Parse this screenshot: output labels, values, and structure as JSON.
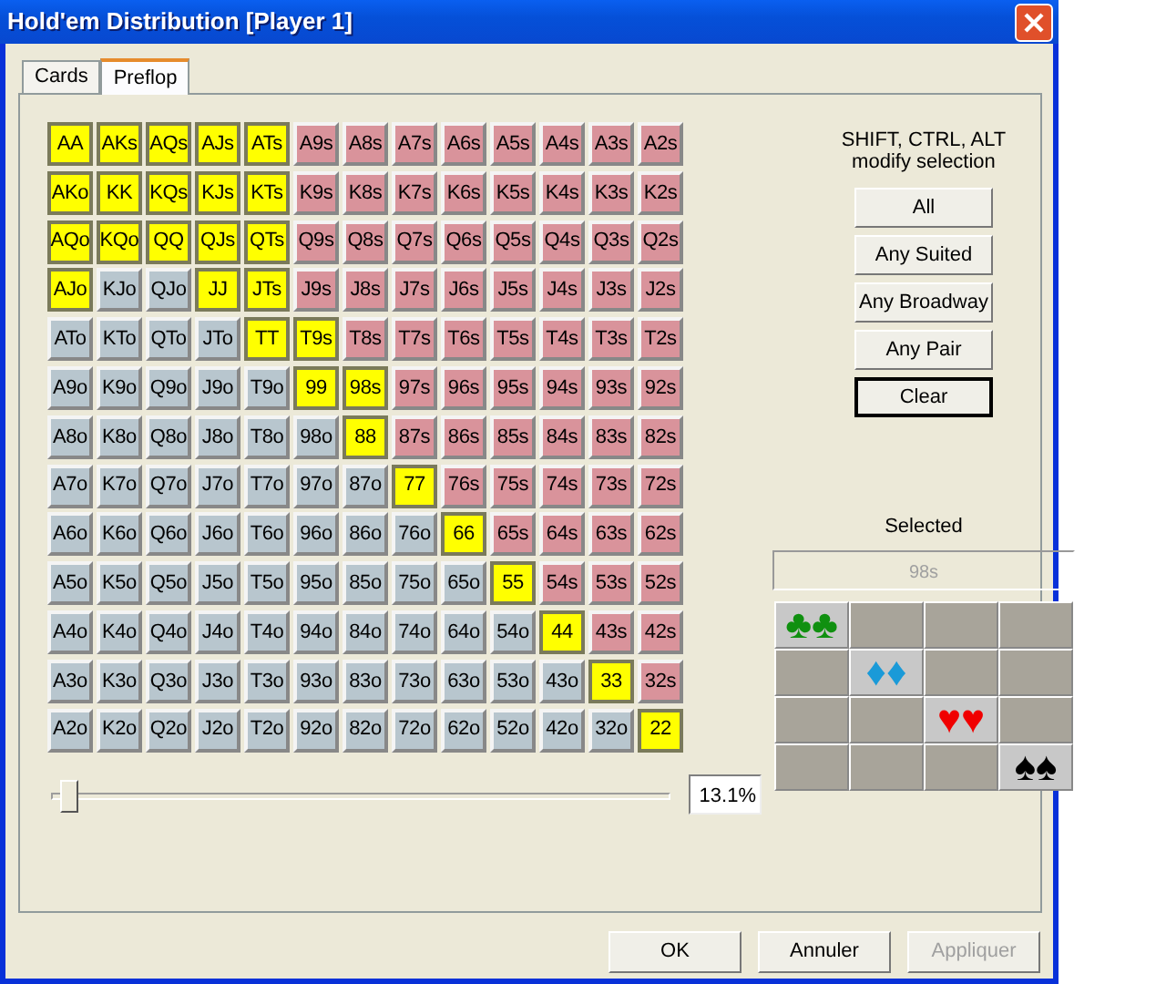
{
  "window": {
    "title": "Hold'em Distribution [Player 1]"
  },
  "tabs": [
    {
      "label": "Cards",
      "selected": false
    },
    {
      "label": "Preflop",
      "selected": true
    }
  ],
  "hand_grid": [
    [
      {
        "label": "AA",
        "kind": "pair",
        "selected": true
      },
      {
        "label": "AKs",
        "kind": "suited",
        "selected": true
      },
      {
        "label": "AQs",
        "kind": "suited",
        "selected": true
      },
      {
        "label": "AJs",
        "kind": "suited",
        "selected": true
      },
      {
        "label": "ATs",
        "kind": "suited",
        "selected": true
      },
      {
        "label": "A9s",
        "kind": "suited",
        "selected": false
      },
      {
        "label": "A8s",
        "kind": "suited",
        "selected": false
      },
      {
        "label": "A7s",
        "kind": "suited",
        "selected": false
      },
      {
        "label": "A6s",
        "kind": "suited",
        "selected": false
      },
      {
        "label": "A5s",
        "kind": "suited",
        "selected": false
      },
      {
        "label": "A4s",
        "kind": "suited",
        "selected": false
      },
      {
        "label": "A3s",
        "kind": "suited",
        "selected": false
      },
      {
        "label": "A2s",
        "kind": "suited",
        "selected": false
      }
    ],
    [
      {
        "label": "AKo",
        "kind": "offsuit",
        "selected": true
      },
      {
        "label": "KK",
        "kind": "pair",
        "selected": true
      },
      {
        "label": "KQs",
        "kind": "suited",
        "selected": true
      },
      {
        "label": "KJs",
        "kind": "suited",
        "selected": true
      },
      {
        "label": "KTs",
        "kind": "suited",
        "selected": true
      },
      {
        "label": "K9s",
        "kind": "suited",
        "selected": false
      },
      {
        "label": "K8s",
        "kind": "suited",
        "selected": false
      },
      {
        "label": "K7s",
        "kind": "suited",
        "selected": false
      },
      {
        "label": "K6s",
        "kind": "suited",
        "selected": false
      },
      {
        "label": "K5s",
        "kind": "suited",
        "selected": false
      },
      {
        "label": "K4s",
        "kind": "suited",
        "selected": false
      },
      {
        "label": "K3s",
        "kind": "suited",
        "selected": false
      },
      {
        "label": "K2s",
        "kind": "suited",
        "selected": false
      }
    ],
    [
      {
        "label": "AQo",
        "kind": "offsuit",
        "selected": true
      },
      {
        "label": "KQo",
        "kind": "offsuit",
        "selected": true
      },
      {
        "label": "QQ",
        "kind": "pair",
        "selected": true
      },
      {
        "label": "QJs",
        "kind": "suited",
        "selected": true
      },
      {
        "label": "QTs",
        "kind": "suited",
        "selected": true
      },
      {
        "label": "Q9s",
        "kind": "suited",
        "selected": false
      },
      {
        "label": "Q8s",
        "kind": "suited",
        "selected": false
      },
      {
        "label": "Q7s",
        "kind": "suited",
        "selected": false
      },
      {
        "label": "Q6s",
        "kind": "suited",
        "selected": false
      },
      {
        "label": "Q5s",
        "kind": "suited",
        "selected": false
      },
      {
        "label": "Q4s",
        "kind": "suited",
        "selected": false
      },
      {
        "label": "Q3s",
        "kind": "suited",
        "selected": false
      },
      {
        "label": "Q2s",
        "kind": "suited",
        "selected": false
      }
    ],
    [
      {
        "label": "AJo",
        "kind": "offsuit",
        "selected": true
      },
      {
        "label": "KJo",
        "kind": "offsuit",
        "selected": false
      },
      {
        "label": "QJo",
        "kind": "offsuit",
        "selected": false
      },
      {
        "label": "JJ",
        "kind": "pair",
        "selected": true
      },
      {
        "label": "JTs",
        "kind": "suited",
        "selected": true
      },
      {
        "label": "J9s",
        "kind": "suited",
        "selected": false
      },
      {
        "label": "J8s",
        "kind": "suited",
        "selected": false
      },
      {
        "label": "J7s",
        "kind": "suited",
        "selected": false
      },
      {
        "label": "J6s",
        "kind": "suited",
        "selected": false
      },
      {
        "label": "J5s",
        "kind": "suited",
        "selected": false
      },
      {
        "label": "J4s",
        "kind": "suited",
        "selected": false
      },
      {
        "label": "J3s",
        "kind": "suited",
        "selected": false
      },
      {
        "label": "J2s",
        "kind": "suited",
        "selected": false
      }
    ],
    [
      {
        "label": "ATo",
        "kind": "offsuit",
        "selected": false
      },
      {
        "label": "KTo",
        "kind": "offsuit",
        "selected": false
      },
      {
        "label": "QTo",
        "kind": "offsuit",
        "selected": false
      },
      {
        "label": "JTo",
        "kind": "offsuit",
        "selected": false
      },
      {
        "label": "TT",
        "kind": "pair",
        "selected": true
      },
      {
        "label": "T9s",
        "kind": "suited",
        "selected": true
      },
      {
        "label": "T8s",
        "kind": "suited",
        "selected": false
      },
      {
        "label": "T7s",
        "kind": "suited",
        "selected": false
      },
      {
        "label": "T6s",
        "kind": "suited",
        "selected": false
      },
      {
        "label": "T5s",
        "kind": "suited",
        "selected": false
      },
      {
        "label": "T4s",
        "kind": "suited",
        "selected": false
      },
      {
        "label": "T3s",
        "kind": "suited",
        "selected": false
      },
      {
        "label": "T2s",
        "kind": "suited",
        "selected": false
      }
    ],
    [
      {
        "label": "A9o",
        "kind": "offsuit",
        "selected": false
      },
      {
        "label": "K9o",
        "kind": "offsuit",
        "selected": false
      },
      {
        "label": "Q9o",
        "kind": "offsuit",
        "selected": false
      },
      {
        "label": "J9o",
        "kind": "offsuit",
        "selected": false
      },
      {
        "label": "T9o",
        "kind": "offsuit",
        "selected": false
      },
      {
        "label": "99",
        "kind": "pair",
        "selected": true
      },
      {
        "label": "98s",
        "kind": "suited",
        "selected": true
      },
      {
        "label": "97s",
        "kind": "suited",
        "selected": false
      },
      {
        "label": "96s",
        "kind": "suited",
        "selected": false
      },
      {
        "label": "95s",
        "kind": "suited",
        "selected": false
      },
      {
        "label": "94s",
        "kind": "suited",
        "selected": false
      },
      {
        "label": "93s",
        "kind": "suited",
        "selected": false
      },
      {
        "label": "92s",
        "kind": "suited",
        "selected": false
      }
    ],
    [
      {
        "label": "A8o",
        "kind": "offsuit",
        "selected": false
      },
      {
        "label": "K8o",
        "kind": "offsuit",
        "selected": false
      },
      {
        "label": "Q8o",
        "kind": "offsuit",
        "selected": false
      },
      {
        "label": "J8o",
        "kind": "offsuit",
        "selected": false
      },
      {
        "label": "T8o",
        "kind": "offsuit",
        "selected": false
      },
      {
        "label": "98o",
        "kind": "offsuit",
        "selected": false
      },
      {
        "label": "88",
        "kind": "pair",
        "selected": true
      },
      {
        "label": "87s",
        "kind": "suited",
        "selected": false
      },
      {
        "label": "86s",
        "kind": "suited",
        "selected": false
      },
      {
        "label": "85s",
        "kind": "suited",
        "selected": false
      },
      {
        "label": "84s",
        "kind": "suited",
        "selected": false
      },
      {
        "label": "83s",
        "kind": "suited",
        "selected": false
      },
      {
        "label": "82s",
        "kind": "suited",
        "selected": false
      }
    ],
    [
      {
        "label": "A7o",
        "kind": "offsuit",
        "selected": false
      },
      {
        "label": "K7o",
        "kind": "offsuit",
        "selected": false
      },
      {
        "label": "Q7o",
        "kind": "offsuit",
        "selected": false
      },
      {
        "label": "J7o",
        "kind": "offsuit",
        "selected": false
      },
      {
        "label": "T7o",
        "kind": "offsuit",
        "selected": false
      },
      {
        "label": "97o",
        "kind": "offsuit",
        "selected": false
      },
      {
        "label": "87o",
        "kind": "offsuit",
        "selected": false
      },
      {
        "label": "77",
        "kind": "pair",
        "selected": true
      },
      {
        "label": "76s",
        "kind": "suited",
        "selected": false
      },
      {
        "label": "75s",
        "kind": "suited",
        "selected": false
      },
      {
        "label": "74s",
        "kind": "suited",
        "selected": false
      },
      {
        "label": "73s",
        "kind": "suited",
        "selected": false
      },
      {
        "label": "72s",
        "kind": "suited",
        "selected": false
      }
    ],
    [
      {
        "label": "A6o",
        "kind": "offsuit",
        "selected": false
      },
      {
        "label": "K6o",
        "kind": "offsuit",
        "selected": false
      },
      {
        "label": "Q6o",
        "kind": "offsuit",
        "selected": false
      },
      {
        "label": "J6o",
        "kind": "offsuit",
        "selected": false
      },
      {
        "label": "T6o",
        "kind": "offsuit",
        "selected": false
      },
      {
        "label": "96o",
        "kind": "offsuit",
        "selected": false
      },
      {
        "label": "86o",
        "kind": "offsuit",
        "selected": false
      },
      {
        "label": "76o",
        "kind": "offsuit",
        "selected": false
      },
      {
        "label": "66",
        "kind": "pair",
        "selected": true
      },
      {
        "label": "65s",
        "kind": "suited",
        "selected": false
      },
      {
        "label": "64s",
        "kind": "suited",
        "selected": false
      },
      {
        "label": "63s",
        "kind": "suited",
        "selected": false
      },
      {
        "label": "62s",
        "kind": "suited",
        "selected": false
      }
    ],
    [
      {
        "label": "A5o",
        "kind": "offsuit",
        "selected": false
      },
      {
        "label": "K5o",
        "kind": "offsuit",
        "selected": false
      },
      {
        "label": "Q5o",
        "kind": "offsuit",
        "selected": false
      },
      {
        "label": "J5o",
        "kind": "offsuit",
        "selected": false
      },
      {
        "label": "T5o",
        "kind": "offsuit",
        "selected": false
      },
      {
        "label": "95o",
        "kind": "offsuit",
        "selected": false
      },
      {
        "label": "85o",
        "kind": "offsuit",
        "selected": false
      },
      {
        "label": "75o",
        "kind": "offsuit",
        "selected": false
      },
      {
        "label": "65o",
        "kind": "offsuit",
        "selected": false
      },
      {
        "label": "55",
        "kind": "pair",
        "selected": true
      },
      {
        "label": "54s",
        "kind": "suited",
        "selected": false
      },
      {
        "label": "53s",
        "kind": "suited",
        "selected": false
      },
      {
        "label": "52s",
        "kind": "suited",
        "selected": false
      }
    ],
    [
      {
        "label": "A4o",
        "kind": "offsuit",
        "selected": false
      },
      {
        "label": "K4o",
        "kind": "offsuit",
        "selected": false
      },
      {
        "label": "Q4o",
        "kind": "offsuit",
        "selected": false
      },
      {
        "label": "J4o",
        "kind": "offsuit",
        "selected": false
      },
      {
        "label": "T4o",
        "kind": "offsuit",
        "selected": false
      },
      {
        "label": "94o",
        "kind": "offsuit",
        "selected": false
      },
      {
        "label": "84o",
        "kind": "offsuit",
        "selected": false
      },
      {
        "label": "74o",
        "kind": "offsuit",
        "selected": false
      },
      {
        "label": "64o",
        "kind": "offsuit",
        "selected": false
      },
      {
        "label": "54o",
        "kind": "offsuit",
        "selected": false
      },
      {
        "label": "44",
        "kind": "pair",
        "selected": true
      },
      {
        "label": "43s",
        "kind": "suited",
        "selected": false
      },
      {
        "label": "42s",
        "kind": "suited",
        "selected": false
      }
    ],
    [
      {
        "label": "A3o",
        "kind": "offsuit",
        "selected": false
      },
      {
        "label": "K3o",
        "kind": "offsuit",
        "selected": false
      },
      {
        "label": "Q3o",
        "kind": "offsuit",
        "selected": false
      },
      {
        "label": "J3o",
        "kind": "offsuit",
        "selected": false
      },
      {
        "label": "T3o",
        "kind": "offsuit",
        "selected": false
      },
      {
        "label": "93o",
        "kind": "offsuit",
        "selected": false
      },
      {
        "label": "83o",
        "kind": "offsuit",
        "selected": false
      },
      {
        "label": "73o",
        "kind": "offsuit",
        "selected": false
      },
      {
        "label": "63o",
        "kind": "offsuit",
        "selected": false
      },
      {
        "label": "53o",
        "kind": "offsuit",
        "selected": false
      },
      {
        "label": "43o",
        "kind": "offsuit",
        "selected": false
      },
      {
        "label": "33",
        "kind": "pair",
        "selected": true
      },
      {
        "label": "32s",
        "kind": "suited",
        "selected": false
      }
    ],
    [
      {
        "label": "A2o",
        "kind": "offsuit",
        "selected": false
      },
      {
        "label": "K2o",
        "kind": "offsuit",
        "selected": false
      },
      {
        "label": "Q2o",
        "kind": "offsuit",
        "selected": false
      },
      {
        "label": "J2o",
        "kind": "offsuit",
        "selected": false
      },
      {
        "label": "T2o",
        "kind": "offsuit",
        "selected": false
      },
      {
        "label": "92o",
        "kind": "offsuit",
        "selected": false
      },
      {
        "label": "82o",
        "kind": "offsuit",
        "selected": false
      },
      {
        "label": "72o",
        "kind": "offsuit",
        "selected": false
      },
      {
        "label": "62o",
        "kind": "offsuit",
        "selected": false
      },
      {
        "label": "52o",
        "kind": "offsuit",
        "selected": false
      },
      {
        "label": "42o",
        "kind": "offsuit",
        "selected": false
      },
      {
        "label": "32o",
        "kind": "offsuit",
        "selected": false
      },
      {
        "label": "22",
        "kind": "pair",
        "selected": true
      }
    ]
  ],
  "range_slider": {
    "level": 0.02,
    "reading": "13.1%"
  },
  "hint": {
    "line_1": "SHIFT, CTRL, ALT",
    "line_2": "modify selection"
  },
  "select_buttons": [
    {
      "label": "All",
      "default": false
    },
    {
      "label": "Any Suited",
      "default": false
    },
    {
      "label": "Any Broadway",
      "default": false
    },
    {
      "label": "Any Pair",
      "default": false
    },
    {
      "label": "Clear",
      "default": true
    }
  ],
  "selected_section": {
    "label": "Selected",
    "value": "98s"
  },
  "suit_matrix": [
    [
      {
        "suits": "♣♣",
        "color": "#109010",
        "selected": true
      },
      {
        "selected": false
      },
      {
        "selected": false
      },
      {
        "selected": false
      }
    ],
    [
      {
        "selected": false
      },
      {
        "suits": "♦♦",
        "color": "#1a9ad8",
        "selected": true
      },
      {
        "selected": false
      },
      {
        "selected": false
      }
    ],
    [
      {
        "selected": false
      },
      {
        "selected": false
      },
      {
        "suits": "♥♥",
        "color": "#f00000",
        "selected": true
      },
      {
        "selected": false
      }
    ],
    [
      {
        "selected": false
      },
      {
        "selected": false
      },
      {
        "selected": false
      },
      {
        "suits": "♠♠",
        "color": "#000000",
        "selected": true
      }
    ]
  ],
  "footer_buttons": [
    {
      "label": "OK",
      "disabled": false
    },
    {
      "label": "Annuler",
      "disabled": false
    },
    {
      "label": "Appliquer",
      "disabled": true
    }
  ]
}
